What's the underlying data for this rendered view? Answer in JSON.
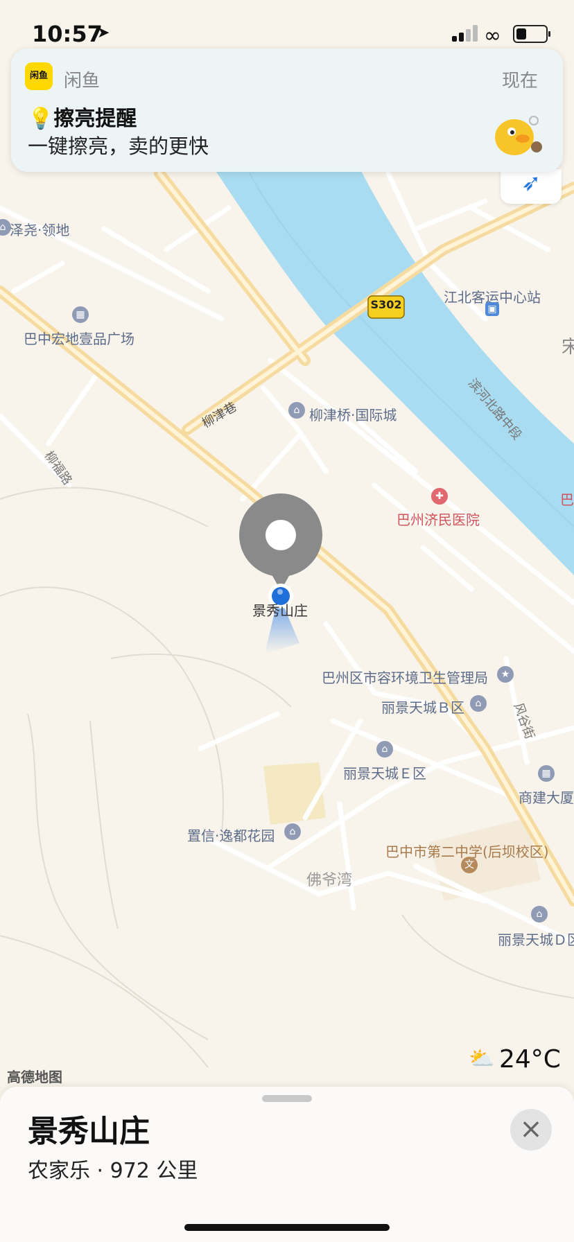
{
  "status_bar": {
    "time": "10:57"
  },
  "notification": {
    "app_icon_text": "闲鱼",
    "app_name": "闲鱼",
    "time": "现在",
    "title": "💡擦亮提醒",
    "body": "一键擦亮，卖的更快"
  },
  "map": {
    "labels": {
      "zeyao": "泽尧·领地",
      "bazhong_hongdi": "巴中宏地壹品广场",
      "road_s302": "S302",
      "jiangbei_station": "江北客运中心站",
      "binhe_road": "滨河北路中段",
      "song_partial": "宋",
      "liujin_lane": "柳津巷",
      "liujin_bridge": "柳津桥·国际城",
      "liufu_road": "柳福路",
      "bazhou_hospital": "巴州济民医院",
      "ba_partial": "巴",
      "jingxiu_map_label": "景秀山庄",
      "bazhou_bureau": "巴州区市容环境卫生管理局",
      "lijing_b": "丽景天城Ｂ区",
      "fenggu_street": "风谷街",
      "lijing_e": "丽景天城Ｅ区",
      "shangjian": "商建大厦",
      "zhixin": "置信·逸都花园",
      "no2_school": "巴中市第二中学(后坝校区)",
      "foyewan": "佛爷湾",
      "lijing_d": "丽景天城Ｄ区"
    },
    "attribution": "高德地图"
  },
  "weather": {
    "temperature": "24°C"
  },
  "place_card": {
    "title": "景秀山庄",
    "subtitle": "农家乐 · 972 公里"
  },
  "colors": {
    "river": "#a9dcf0",
    "major_road": "#f6dba0",
    "pin_gray": "#8a8a8a",
    "user_blue": "#1e6fd9",
    "poi_gray": "#8f9bb4",
    "hospital_red": "#e0686e",
    "school_brown": "#b58a5c"
  },
  "icons": [
    "location-arrow-icon",
    "link-icon",
    "battery-icon",
    "compass-icon",
    "weather-partly-cloudy-icon",
    "close-icon"
  ]
}
